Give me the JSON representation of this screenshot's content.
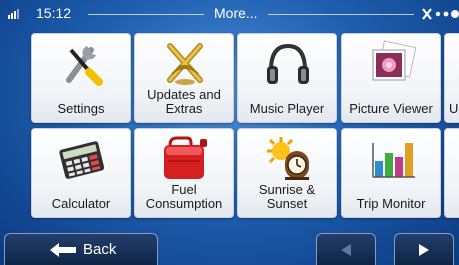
{
  "status": {
    "time": "15:12",
    "title": "More..."
  },
  "tiles": [
    {
      "label": "Settings",
      "icon": "settings-icon"
    },
    {
      "label": "Updates and Extras",
      "icon": "updates-icon"
    },
    {
      "label": "Music Player",
      "icon": "headphones-icon"
    },
    {
      "label": "Picture Viewer",
      "icon": "picture-icon"
    },
    {
      "label": "U",
      "icon": "partial-icon"
    },
    {
      "label": "Calculator",
      "icon": "calculator-icon"
    },
    {
      "label": "Fuel Consumption",
      "icon": "fuel-can-icon"
    },
    {
      "label": "Sunrise & Sunset",
      "icon": "sun-clock-icon"
    },
    {
      "label": "Trip Monitor",
      "icon": "bar-chart-icon"
    }
  ],
  "bottom": {
    "back_label": "Back"
  },
  "colors": {
    "background": "#1f5fb0",
    "tile": "#f3f6f9",
    "fuel": "#d42020",
    "bar": "#0d2546"
  }
}
